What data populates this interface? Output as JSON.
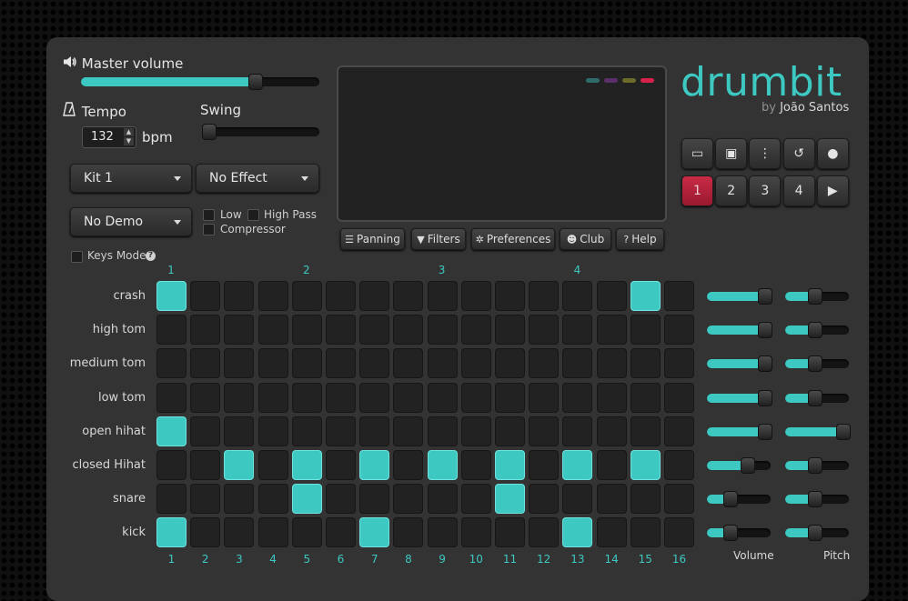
{
  "app": {
    "logo": "drumbit",
    "byline_prefix": "by",
    "author": "João Santos"
  },
  "master": {
    "label": "Master volume",
    "icon": "volume-icon",
    "value": 0.73
  },
  "tempo": {
    "label": "Tempo",
    "icon": "metronome-icon",
    "value": "132",
    "unit": "bpm"
  },
  "swing": {
    "label": "Swing",
    "value": 0.0
  },
  "dropdowns": {
    "kit": "Kit 1",
    "effect": "No Effect",
    "demo": "No Demo"
  },
  "filters": {
    "low": "Low",
    "high_pass": "High Pass",
    "compressor": "Compressor"
  },
  "keys_mode": {
    "label": "Keys Mode",
    "help_icon": "question-circle-icon"
  },
  "screen_leds": [
    "#2e6b6a",
    "#5a2f6b",
    "#6b6b2a",
    "#d6214a"
  ],
  "tabs": [
    {
      "label": "Panning",
      "icon": "sliders-icon",
      "glyph": "☰"
    },
    {
      "label": "Filters",
      "icon": "filter-icon",
      "glyph": "▼"
    },
    {
      "label": "Preferences",
      "icon": "gear-icon",
      "glyph": "✲"
    },
    {
      "label": "Club",
      "icon": "users-icon",
      "glyph": "☻"
    },
    {
      "label": "Help",
      "icon": "question-icon",
      "glyph": "?"
    }
  ],
  "toolbar": [
    {
      "name": "open-icon",
      "glyph": "▭"
    },
    {
      "name": "save-icon",
      "glyph": "▣"
    },
    {
      "name": "menu-icon",
      "glyph": "⋮"
    },
    {
      "name": "undo-icon",
      "glyph": "↺"
    },
    {
      "name": "record-icon",
      "glyph": "●"
    }
  ],
  "patterns": {
    "items": [
      "1",
      "2",
      "3",
      "4"
    ],
    "active": 0,
    "play_glyph": "▶"
  },
  "beat_markers": [
    "1",
    "2",
    "3",
    "4"
  ],
  "step_numbers": [
    "1",
    "2",
    "3",
    "4",
    "5",
    "6",
    "7",
    "8",
    "9",
    "10",
    "11",
    "12",
    "13",
    "14",
    "15",
    "16"
  ],
  "tracks": [
    {
      "name": "crash",
      "steps": [
        1,
        0,
        0,
        0,
        0,
        0,
        0,
        0,
        0,
        0,
        0,
        0,
        0,
        0,
        1,
        0
      ],
      "volume": 0.9,
      "pitch": 0.45
    },
    {
      "name": "high tom",
      "steps": [
        0,
        0,
        0,
        0,
        0,
        0,
        0,
        0,
        0,
        0,
        0,
        0,
        0,
        0,
        0,
        0
      ],
      "volume": 0.9,
      "pitch": 0.45
    },
    {
      "name": "medium tom",
      "steps": [
        0,
        0,
        0,
        0,
        0,
        0,
        0,
        0,
        0,
        0,
        0,
        0,
        0,
        0,
        0,
        0
      ],
      "volume": 0.9,
      "pitch": 0.45
    },
    {
      "name": "low tom",
      "steps": [
        0,
        0,
        0,
        0,
        0,
        0,
        0,
        0,
        0,
        0,
        0,
        0,
        0,
        0,
        0,
        0
      ],
      "volume": 0.9,
      "pitch": 0.45
    },
    {
      "name": "open hihat",
      "steps": [
        1,
        0,
        0,
        0,
        0,
        0,
        0,
        0,
        0,
        0,
        0,
        0,
        0,
        0,
        0,
        0
      ],
      "volume": 0.9,
      "pitch": 0.98
    },
    {
      "name": "closed Hihat",
      "steps": [
        0,
        0,
        1,
        0,
        1,
        0,
        1,
        0,
        1,
        0,
        1,
        0,
        1,
        0,
        1,
        0
      ],
      "volume": 0.63,
      "pitch": 0.45
    },
    {
      "name": "snare",
      "steps": [
        0,
        0,
        0,
        0,
        1,
        0,
        0,
        0,
        0,
        0,
        1,
        0,
        0,
        0,
        0,
        0
      ],
      "volume": 0.35,
      "pitch": 0.45
    },
    {
      "name": "kick",
      "steps": [
        1,
        0,
        0,
        0,
        0,
        0,
        1,
        0,
        0,
        0,
        0,
        0,
        1,
        0,
        0,
        0
      ],
      "volume": 0.35,
      "pitch": 0.45
    }
  ],
  "column_labels": {
    "volume": "Volume",
    "pitch": "Pitch"
  }
}
